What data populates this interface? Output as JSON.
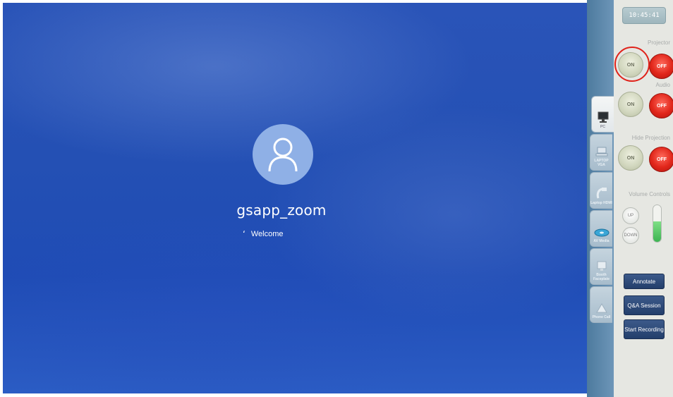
{
  "login": {
    "username": "gsapp_zoom",
    "status_text": "Welcome",
    "spinner_glyph": "‘"
  },
  "sources": [
    {
      "label": "PC",
      "icon": "monitor-icon",
      "active": true
    },
    {
      "label": "LAPTOP VGA",
      "icon": "laptop-icon",
      "active": false
    },
    {
      "label": "Laptop HDMI",
      "icon": "hdmi-cable-icon",
      "active": false
    },
    {
      "label": "AV Media",
      "icon": "disc-icon",
      "active": false
    },
    {
      "label": "Booth Faceplate",
      "icon": "faceplate-icon",
      "active": false
    },
    {
      "label": "Phone Call",
      "icon": "phone-icon",
      "active": false
    }
  ],
  "panel": {
    "clock": "10:45:41",
    "projector": {
      "label": "Projector",
      "on": "ON",
      "off": "OFF"
    },
    "audio": {
      "label": "Audio",
      "on": "ON",
      "off": "OFF"
    },
    "hide_projection": {
      "label": "Hide Projection",
      "on": "ON",
      "off": "OFF"
    },
    "volume": {
      "label": "Volume Controls",
      "up": "UP",
      "down": "DOWN",
      "level": 0.55
    },
    "actions": {
      "annotate": "Annotate",
      "qa_session": "Q&A Session",
      "start_recording": "Start Recording"
    }
  },
  "colors": {
    "on_button": "#d3d8c0",
    "off_button": "#e1271b",
    "action_button": "#2b4775",
    "highlight_ring": "#e0221a",
    "volume_fill": "#3cb451"
  }
}
